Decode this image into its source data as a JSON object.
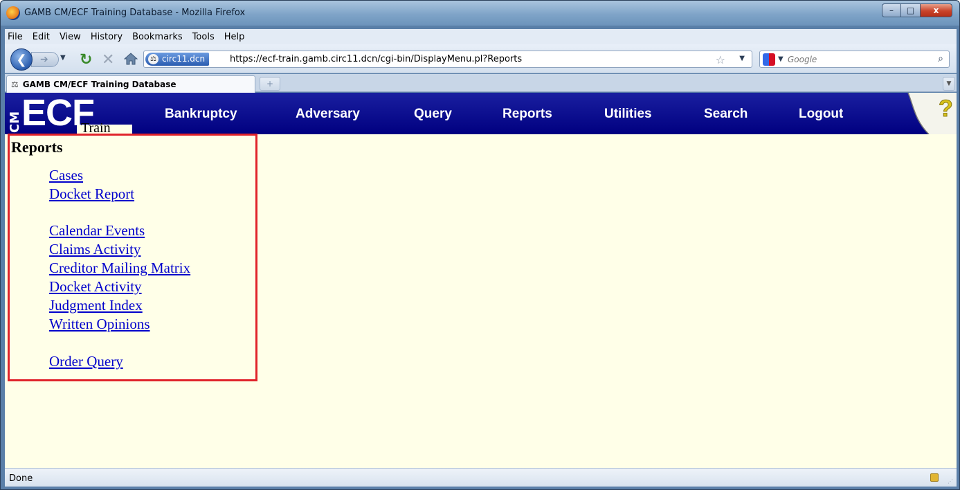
{
  "window": {
    "title": "GAMB CM/ECF Training Database - Mozilla Firefox",
    "controls": {
      "minimize": "–",
      "maximize": "□",
      "close": "x"
    }
  },
  "menubar": {
    "items": [
      {
        "label": "File",
        "accel": "F"
      },
      {
        "label": "Edit",
        "accel": "E"
      },
      {
        "label": "View",
        "accel": "V"
      },
      {
        "label": "History",
        "accel": "s"
      },
      {
        "label": "Bookmarks",
        "accel": "B"
      },
      {
        "label": "Tools",
        "accel": "T"
      },
      {
        "label": "Help",
        "accel": "H"
      }
    ]
  },
  "navbar": {
    "site_badge": "circ11.dcn",
    "url": "https://ecf-train.gamb.circ11.dcn/cgi-bin/DisplayMenu.pl?Reports",
    "search_placeholder": "Google",
    "icons": [
      "back-icon",
      "forward-icon",
      "reload-icon",
      "stop-icon",
      "home-icon",
      "star-icon",
      "search-icon"
    ]
  },
  "tabs": [
    {
      "label": "GAMB CM/ECF Training Database",
      "active": true
    }
  ],
  "ecf": {
    "logo": {
      "cm": "CM",
      "ecf": "ECF",
      "train": "Train"
    },
    "nav": [
      "Bankruptcy",
      "Adversary",
      "Query",
      "Reports",
      "Utilities",
      "Search",
      "Logout"
    ],
    "help_glyph": "?"
  },
  "reports": {
    "title": "Reports",
    "links": [
      "Cases",
      "Docket Report",
      "Calendar Events",
      "Claims Activity",
      "Creditor Mailing Matrix",
      "Docket Activity",
      "Judgment Index",
      "Written Opinions",
      "Order Query"
    ],
    "highlight_color": "#e0232a"
  },
  "statusbar": {
    "text": "Done"
  },
  "colors": {
    "ecf_header": "#000080",
    "content_bg": "#ffffe8",
    "link": "#0000cc"
  }
}
